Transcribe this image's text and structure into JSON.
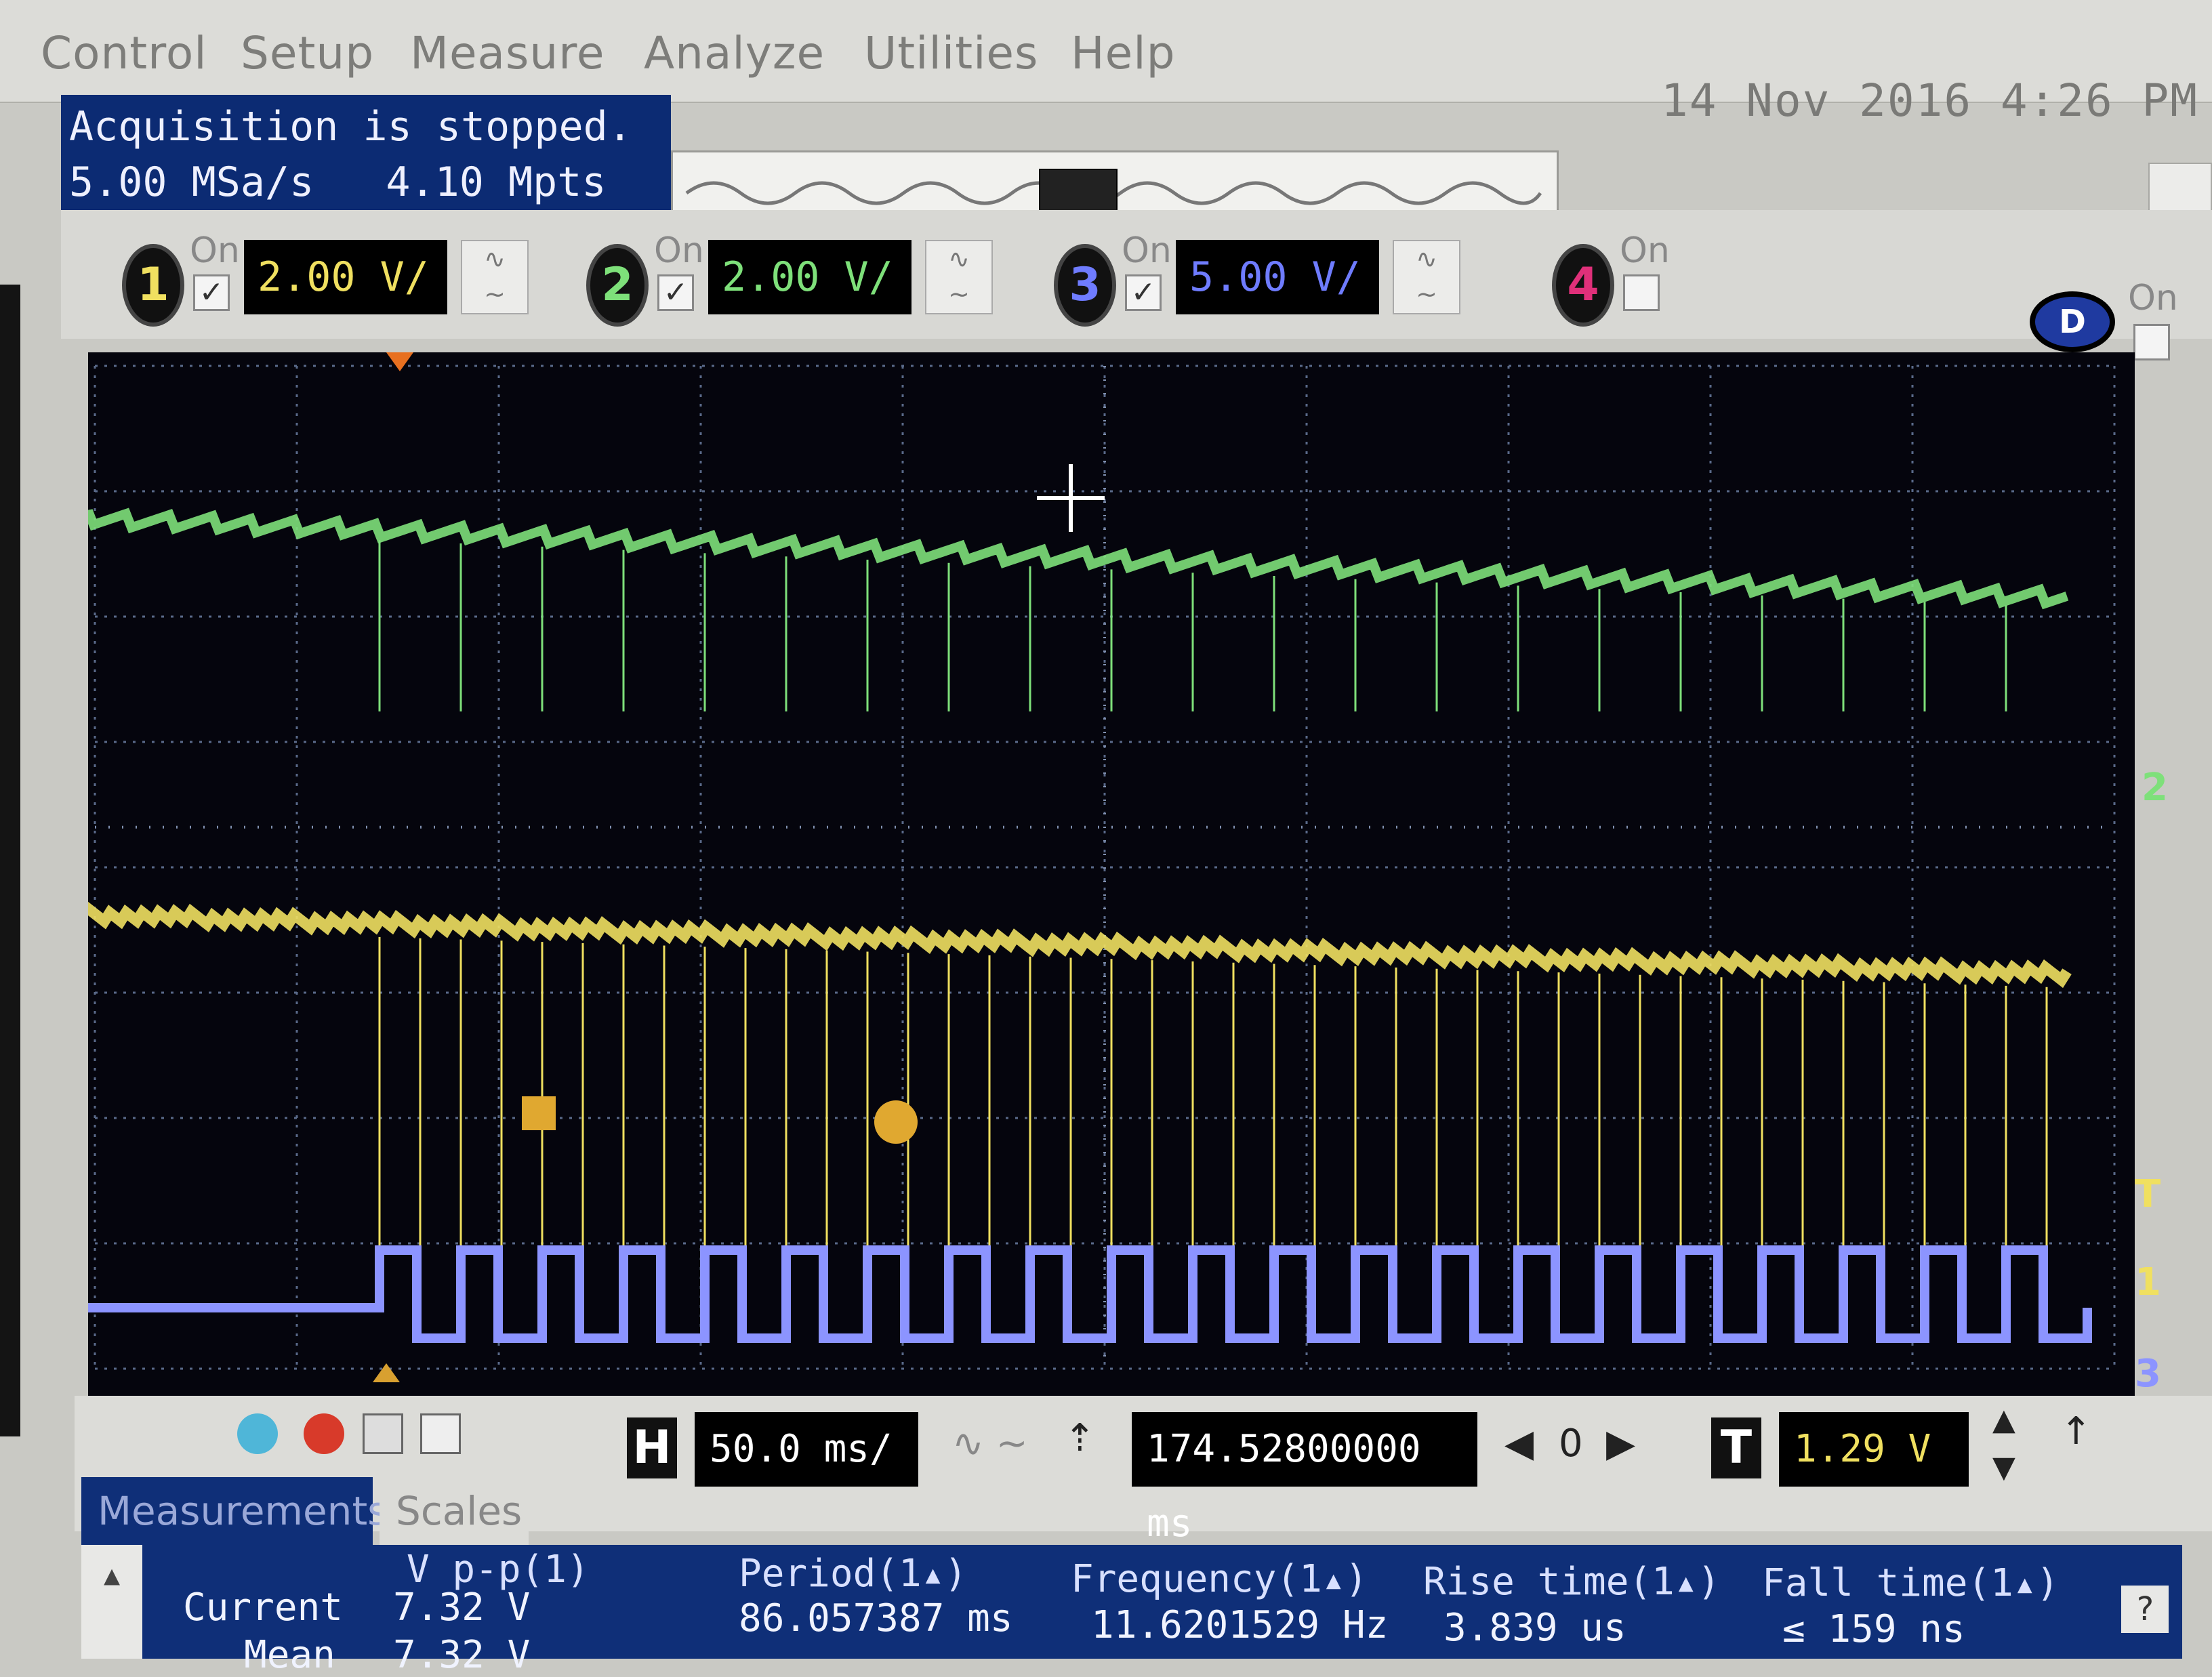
{
  "menu": {
    "items": [
      "Control",
      "Setup",
      "Measure",
      "Analyze",
      "Utilities",
      "Help"
    ],
    "datetime": "14 Nov 2016  4:26 PM"
  },
  "status": {
    "acquisition": "Acquisition is stopped.",
    "sample_rate": "5.00 MSa/s",
    "memory_depth": "4.10 Mpts"
  },
  "channels": [
    {
      "number": "1",
      "on_label": "On",
      "checked": true,
      "scale": "2.00 V/",
      "color": "#f0e060"
    },
    {
      "number": "2",
      "on_label": "On",
      "checked": true,
      "scale": "2.00 V/",
      "color": "#7ee07a"
    },
    {
      "number": "3",
      "on_label": "On",
      "checked": true,
      "scale": "5.00 V/",
      "color": "#6f7cff"
    },
    {
      "number": "4",
      "on_label": "On",
      "checked": false,
      "scale": "",
      "color": "#e0307a"
    }
  ],
  "digital": {
    "label": "D",
    "on_label": "On",
    "checked": false
  },
  "side_markers": {
    "ch2": "2",
    "trigger": "T",
    "ch1": "1",
    "ch3": "3"
  },
  "control": {
    "horizontal_letter": "H",
    "timebase": "50.0 ms/",
    "delay": "174.52800000 ms",
    "delay_ref": "0",
    "trigger_letter": "T",
    "trigger_level": "1.29 V"
  },
  "tabs": {
    "measurements": "Measurements",
    "scales": "Scales"
  },
  "measurements": {
    "row_current": "Current",
    "row_mean": "Mean",
    "columns": [
      {
        "header": "V p-p(1)",
        "current": "7.32 V",
        "mean": "7.32 V"
      },
      {
        "header": "Period(1▴)",
        "current": "86.057387 ms",
        "mean": ""
      },
      {
        "header": "Frequency(1▴)",
        "current": "11.6201529 Hz",
        "mean": ""
      },
      {
        "header": "Rise time(1▴)",
        "current": "3.839 us",
        "mean": ""
      },
      {
        "header": "Fall time(1▴)",
        "current": "≤ 159 ns",
        "mean": ""
      }
    ]
  },
  "colors": {
    "ch1_trace": "#f0e060",
    "ch2_trace": "#7ee07a",
    "ch3_trace": "#8c94ff",
    "grid": "#5a6a8a",
    "screen_bg": "#05050d",
    "panel_blue": "#0f2f78"
  }
}
